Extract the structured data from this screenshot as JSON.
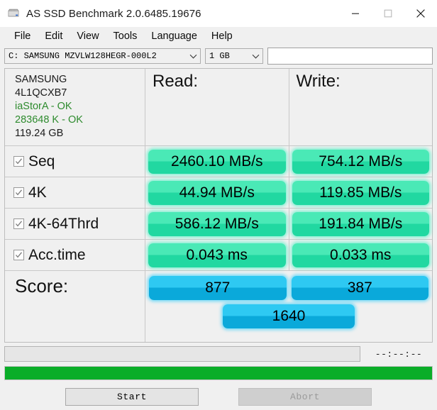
{
  "window": {
    "title": "AS SSD Benchmark 2.0.6485.19676",
    "icon": "ssd-drive-icon",
    "controls": {
      "minimize": "minimize-icon",
      "maximize": "maximize-icon",
      "close": "close-icon"
    }
  },
  "menubar": {
    "items": [
      {
        "label": "File"
      },
      {
        "label": "Edit"
      },
      {
        "label": "View"
      },
      {
        "label": "Tools"
      },
      {
        "label": "Language"
      },
      {
        "label": "Help"
      }
    ]
  },
  "toolbar": {
    "drive_combo": {
      "value": "C: SAMSUNG MZVLW128HEGR-000L2",
      "arrow": "chevron-down-icon"
    },
    "size_combo": {
      "value": "1 GB",
      "arrow": "chevron-down-icon"
    },
    "name_field": {
      "value": "",
      "placeholder": ""
    }
  },
  "device_info": {
    "lines": [
      {
        "text": "SAMSUNG",
        "color": "#1a1a1a"
      },
      {
        "text": "4L1QCXB7",
        "color": "#1a1a1a"
      },
      {
        "text": "iaStorA - OK",
        "color": "#2e8b2e"
      },
      {
        "text": "283648 K - OK",
        "color": "#2e8b2e"
      },
      {
        "text": "119.24 GB",
        "color": "#1a1a1a"
      }
    ]
  },
  "columns": {
    "read": "Read:",
    "write": "Write:"
  },
  "rows": [
    {
      "label": "Seq",
      "checked": true,
      "read": "2460.10 MB/s",
      "write": "754.12 MB/s"
    },
    {
      "label": "4K",
      "checked": true,
      "read": "44.94 MB/s",
      "write": "119.85 MB/s"
    },
    {
      "label": "4K-64Thrd",
      "checked": true,
      "read": "586.12 MB/s",
      "write": "191.84 MB/s"
    },
    {
      "label": "Acc.time",
      "checked": true,
      "read": "0.043 ms",
      "write": "0.033 ms"
    }
  ],
  "score": {
    "label": "Score:",
    "read": "877",
    "write": "387",
    "total": "1640"
  },
  "status": {
    "message": "",
    "timer": "--:--:--"
  },
  "progress": {
    "percent": 100
  },
  "buttons": {
    "start": "Start",
    "abort": "Abort"
  },
  "colors": {
    "pill_green_light": "#4ae9b6",
    "pill_green_dark": "#21d8a1",
    "pill_blue_light": "#2ec9f2",
    "pill_blue_dark": "#0aa9da",
    "progress_green": "#0aad28",
    "ok_text_green": "#2e8b2e"
  }
}
